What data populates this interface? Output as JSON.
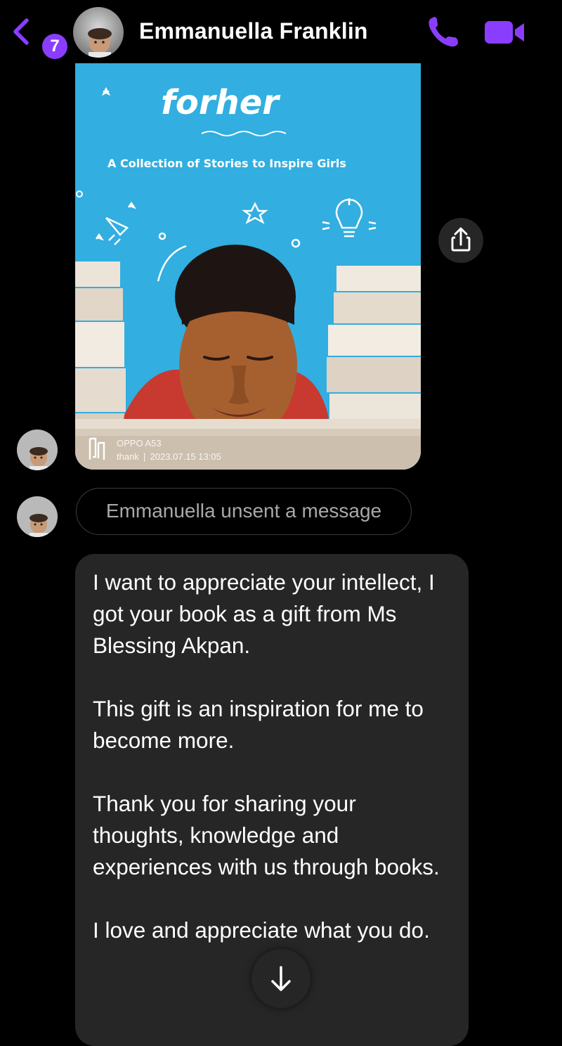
{
  "header": {
    "back_badge_count": "7",
    "contact_name": "Emmanuella Franklin",
    "accent_color": "#8b3dff",
    "icons": [
      "chevron-left-icon",
      "phone-icon",
      "video-camera-icon"
    ]
  },
  "photo": {
    "book_title": "forher",
    "book_subtitle": "A Collection of Stories to Inspire Girls",
    "camera_model": "OPPO A53",
    "camera_caption": "thank  |  2023.07.15 13:05"
  },
  "unsent_notice": "Emmanuella unsent a message",
  "message": {
    "paragraphs": [
      "I want to appreciate your intellect, I got your book as a gift from Ms Blessing Akpan.",
      "This gift is an inspiration for me to become more.",
      "Thank you for sharing your thoughts, knowledge and experiences with us through books.",
      "I love and appreciate what you do."
    ]
  }
}
